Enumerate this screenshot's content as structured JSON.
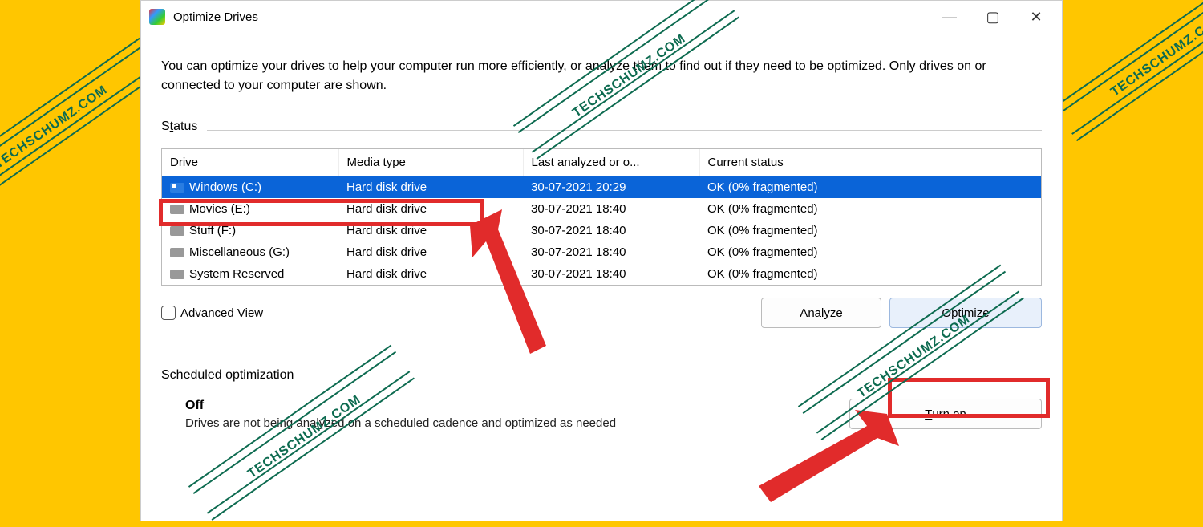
{
  "window": {
    "title": "Optimize Drives",
    "description": "You can optimize your drives to help your computer run more efficiently, or analyze them to find out if they need to be optimized. Only drives on or connected to your computer are shown."
  },
  "status": {
    "label_pre": "S",
    "label_underlined": "t",
    "label_post": "atus",
    "columns": {
      "drive": "Drive",
      "media": "Media type",
      "last": "Last analyzed or o...",
      "status": "Current status"
    },
    "rows": [
      {
        "name": "Windows (C:)",
        "media": "Hard disk drive",
        "last": "30-07-2021 20:29",
        "status": "OK (0% fragmented)",
        "selected": true,
        "os": true
      },
      {
        "name": "Movies (E:)",
        "media": "Hard disk drive",
        "last": "30-07-2021 18:40",
        "status": "OK (0% fragmented)",
        "selected": false,
        "os": false
      },
      {
        "name": "Stuff (F:)",
        "media": "Hard disk drive",
        "last": "30-07-2021 18:40",
        "status": "OK (0% fragmented)",
        "selected": false,
        "os": false
      },
      {
        "name": "Miscellaneous (G:)",
        "media": "Hard disk drive",
        "last": "30-07-2021 18:40",
        "status": "OK (0% fragmented)",
        "selected": false,
        "os": false
      },
      {
        "name": "System Reserved",
        "media": "Hard disk drive",
        "last": "30-07-2021 18:40",
        "status": "OK (0% fragmented)",
        "selected": false,
        "os": false
      }
    ]
  },
  "controls": {
    "advanced_pre": "A",
    "advanced_u": "d",
    "advanced_post": "vanced View",
    "analyze_pre": "A",
    "analyze_u": "n",
    "analyze_post": "alyze",
    "optimize_u": "O",
    "optimize_post": "ptimize"
  },
  "scheduled": {
    "label": "Scheduled optimization",
    "state": "Off",
    "subtitle": "Drives are not being analyzed on a scheduled cadence and optimized as needed",
    "turn_on_u": "T",
    "turn_on_post": "urn on"
  },
  "watermark": "TECHSCHUMZ.COM"
}
